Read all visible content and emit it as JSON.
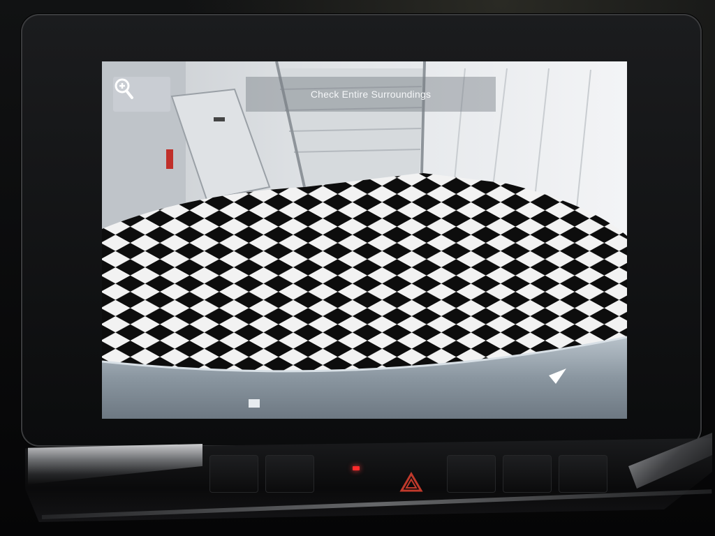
{
  "camera_view": {
    "zoom_icon": "zoom-in-magnifier-icon",
    "banner_text": "Check Entire Surroundings"
  },
  "console": {
    "hazard_icon": "hazard-triangle-icon",
    "indicator_color": "#ff2b2b"
  }
}
